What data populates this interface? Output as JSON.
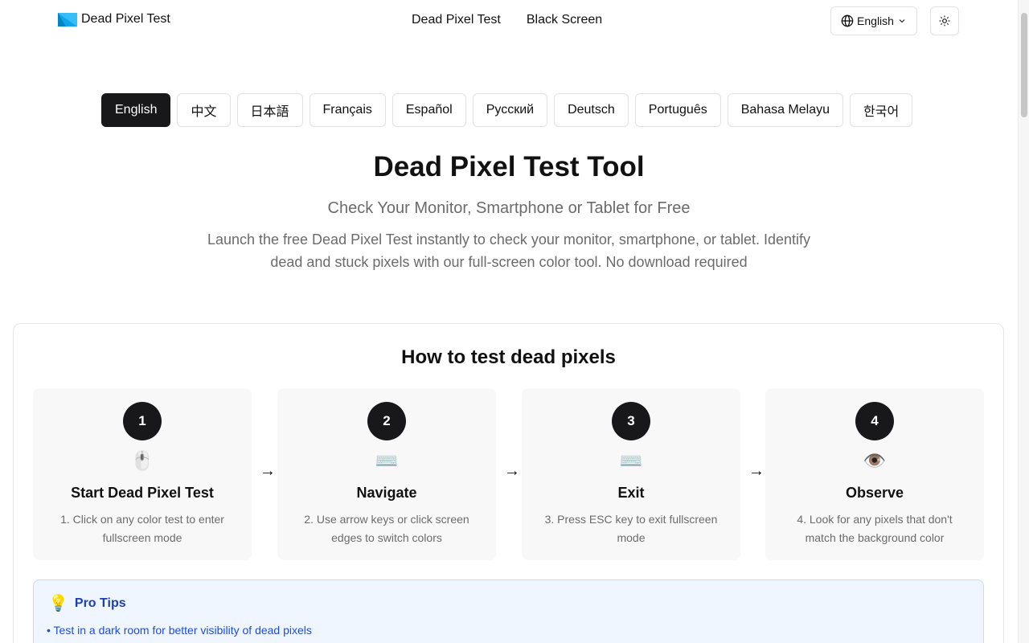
{
  "header": {
    "brand_name": "Dead Pixel Test",
    "nav": [
      "Dead Pixel Test",
      "Black Screen"
    ],
    "language_selected": "English",
    "theme_icon": "sun-icon",
    "globe_icon": "globe-icon"
  },
  "languages": [
    {
      "label": "English",
      "active": true
    },
    {
      "label": "中文",
      "active": false
    },
    {
      "label": "日本語",
      "active": false
    },
    {
      "label": "Français",
      "active": false
    },
    {
      "label": "Español",
      "active": false
    },
    {
      "label": "Русский",
      "active": false
    },
    {
      "label": "Deutsch",
      "active": false
    },
    {
      "label": "Português",
      "active": false
    },
    {
      "label": "Bahasa Melayu",
      "active": false
    },
    {
      "label": "한국어",
      "active": false
    }
  ],
  "hero": {
    "title": "Dead Pixel Test Tool",
    "subtitle": "Check Your Monitor, Smartphone or Tablet for Free",
    "description": "Launch the free Dead Pixel Test instantly to check your monitor, smartphone, or tablet. Identify dead and stuck pixels with our full-screen color tool. No download required"
  },
  "how_to": {
    "title": "How to test dead pixels",
    "arrow": "→",
    "steps": [
      {
        "number": "1",
        "icon": "🖱️",
        "icon_name": "mouse-icon",
        "title": "Start Dead Pixel Test",
        "description": "1. Click on any color test to enter fullscreen mode"
      },
      {
        "number": "2",
        "icon": "⌨️",
        "icon_name": "keyboard-icon",
        "title": "Navigate",
        "description": "2. Use arrow keys or click screen edges to switch colors"
      },
      {
        "number": "3",
        "icon": "⌨️",
        "icon_name": "keyboard-icon",
        "title": "Exit",
        "description": "3. Press ESC key to exit fullscreen mode"
      },
      {
        "number": "4",
        "icon": "👁️",
        "icon_name": "eye-icon",
        "title": "Observe",
        "description": "4. Look for any pixels that don't match the background color"
      }
    ]
  },
  "pro_tips": {
    "icon": "💡",
    "title": "Pro Tips",
    "items": [
      "• Test in a dark room for better visibility of dead pixels"
    ]
  },
  "colors": {
    "dark": "#18181b",
    "border": "#e2e2e2",
    "muted_text": "#6b6b6b",
    "tips_bg": "#eff6ff",
    "tips_text": "#1d4ed8"
  }
}
